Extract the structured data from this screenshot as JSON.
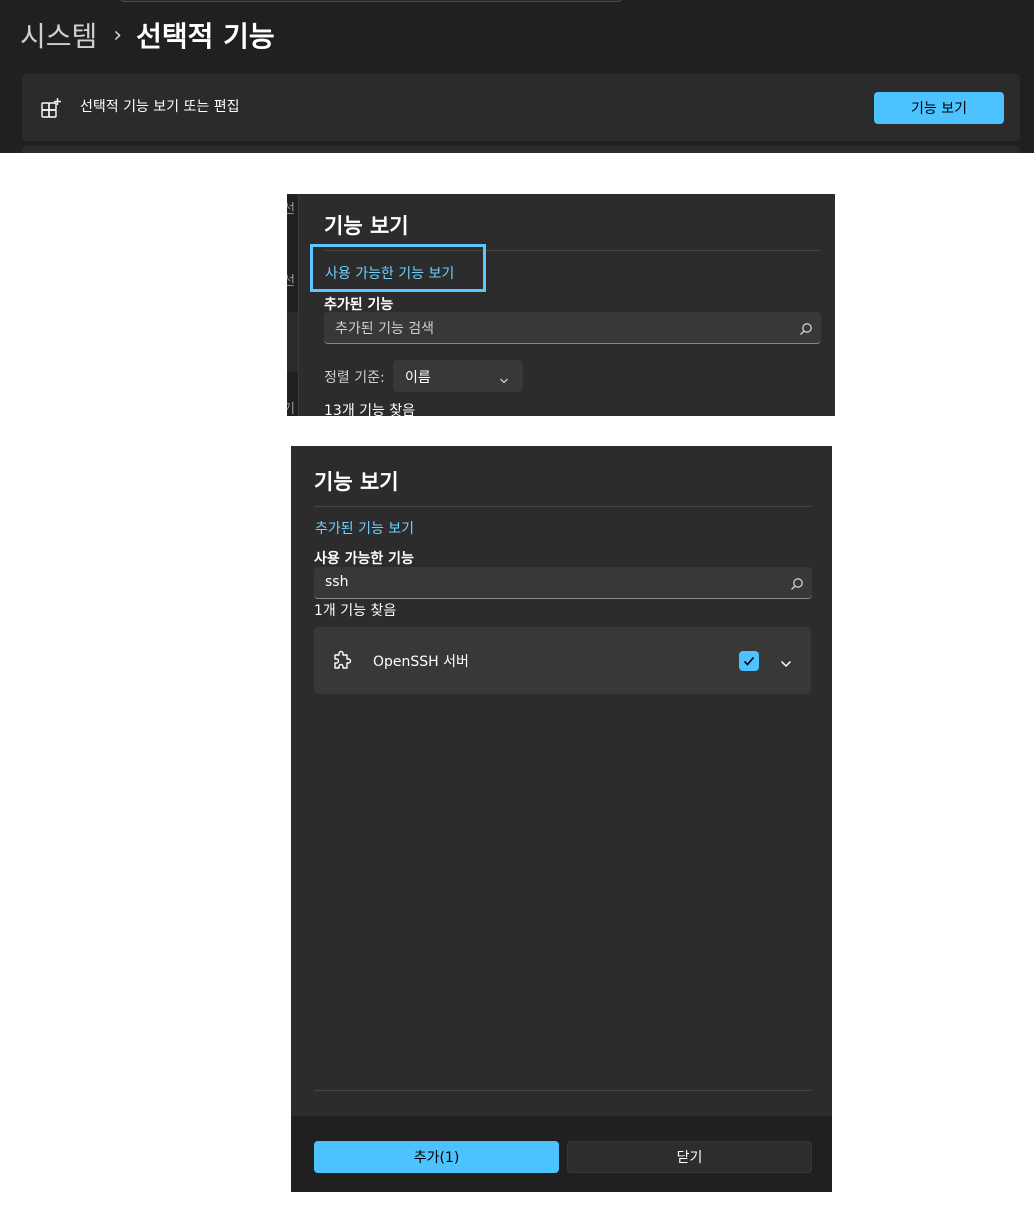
{
  "top": {
    "breadcrumb_parent": "시스템",
    "breadcrumb_separator": "›",
    "breadcrumb_current": "선택적 기능",
    "card_label": "선택적 기능 보기 또는 편집",
    "card_button": "기능 보기",
    "card_icon": "add-apps-icon"
  },
  "mid_dialog": {
    "title": "기능 보기",
    "link": "사용 가능한 기능 보기",
    "subheading": "추가된 기능",
    "search_placeholder": "추가된 기능 검색",
    "sort_label": "정렬 기준:",
    "sort_value": "이름",
    "count": "13개 기능 찾음",
    "background_fragments": [
      "선",
      "선",
      "기"
    ]
  },
  "dialog": {
    "title": "기능 보기",
    "link": "추가된 기능 보기",
    "subheading": "사용 가능한 기능",
    "search_value": "ssh",
    "count": "1개 기능 찾음",
    "result": {
      "name": "OpenSSH 서버",
      "icon": "puzzle-icon",
      "checked": true
    },
    "add_button": "추가(1)",
    "close_button": "닫기"
  },
  "colors": {
    "accent": "#4cc2ff",
    "link": "#6dd0ff",
    "highlight_border": "#5cc6ff",
    "background": "#202020",
    "surface": "#2c2c2c"
  }
}
